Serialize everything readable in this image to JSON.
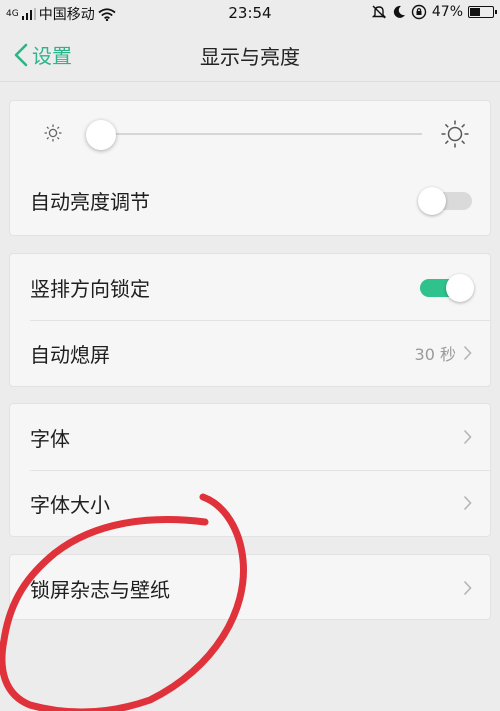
{
  "status_bar": {
    "network": "4G",
    "carrier": "中国移动",
    "time": "23:54",
    "battery_percent": "47%",
    "battery_level": 0.47
  },
  "nav": {
    "back_label": "设置",
    "title": "显示与亮度"
  },
  "brightness": {
    "level": 0.0,
    "auto_label": "自动亮度调节",
    "auto_on": false
  },
  "orientation": {
    "lock_label": "竖排方向锁定",
    "lock_on": true,
    "sleep_label": "自动熄屏",
    "sleep_value": "30 秒"
  },
  "font": {
    "font_label": "字体",
    "size_label": "字体大小"
  },
  "lockscreen": {
    "label": "锁屏杂志与壁纸"
  },
  "colors": {
    "accent": "#2bb589",
    "toggle_on": "#2fc28c",
    "annotation": "#e0323a"
  }
}
